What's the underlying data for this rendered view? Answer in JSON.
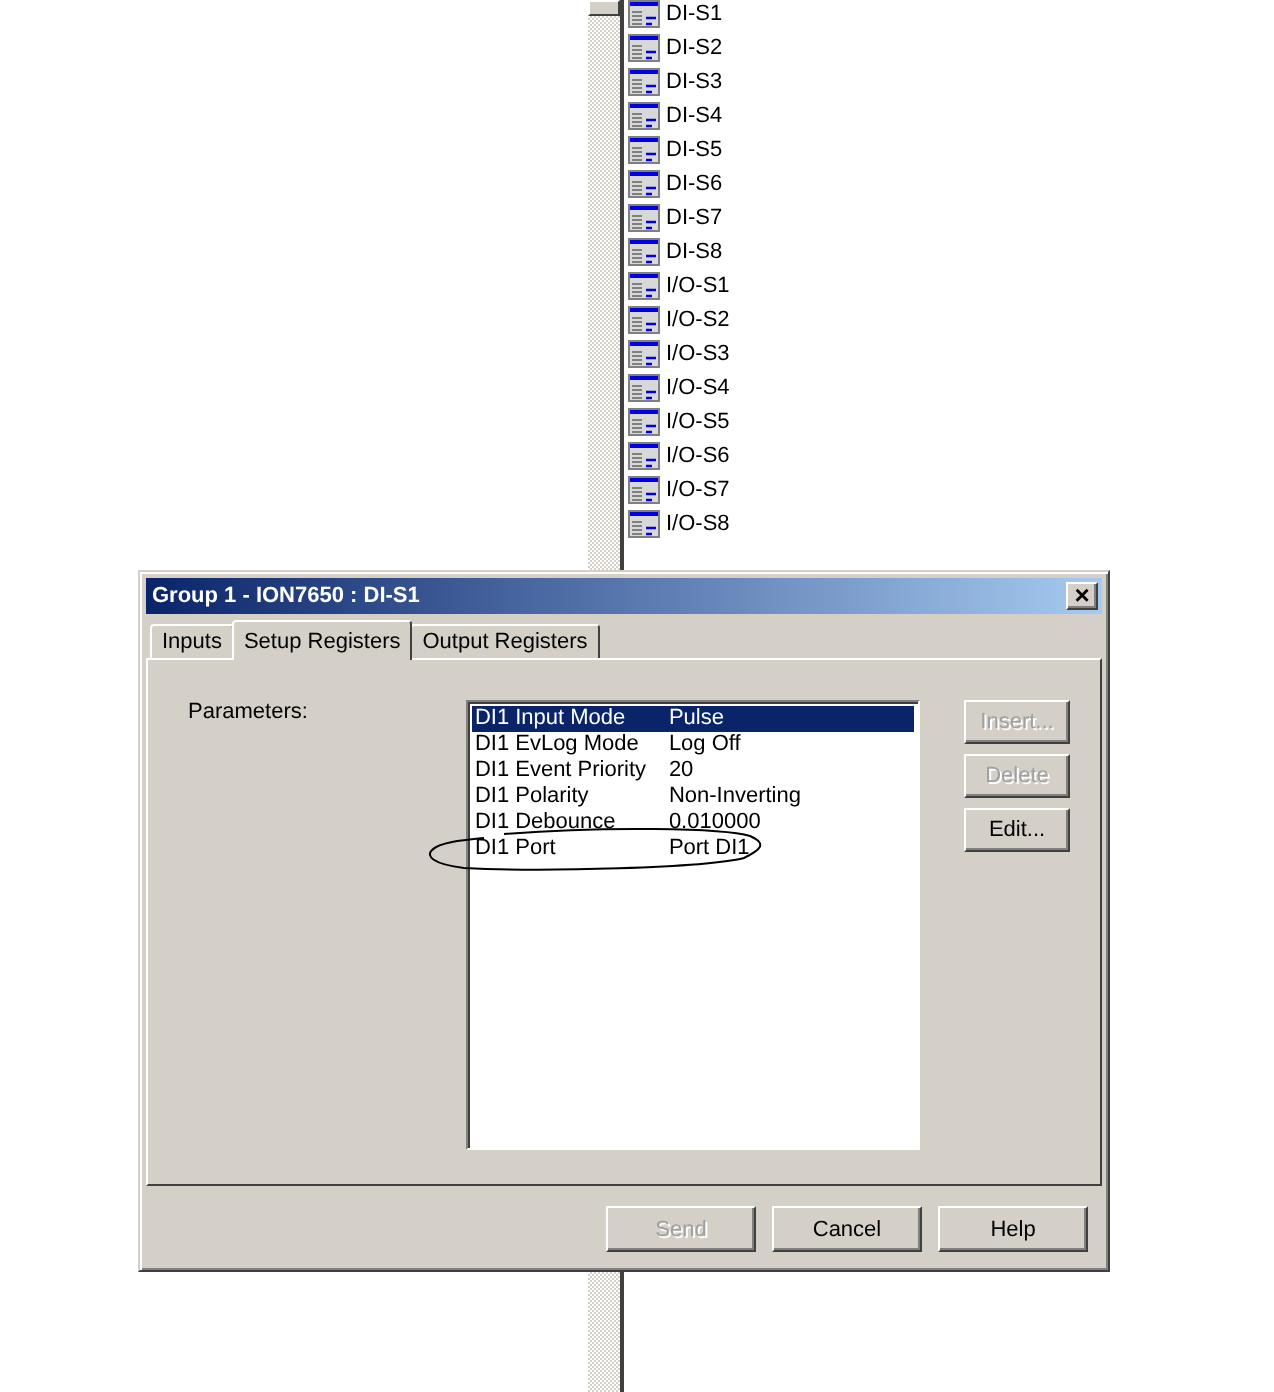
{
  "tree": {
    "items": [
      {
        "label": "DI-S1"
      },
      {
        "label": "DI-S2"
      },
      {
        "label": "DI-S3"
      },
      {
        "label": "DI-S4"
      },
      {
        "label": "DI-S5"
      },
      {
        "label": "DI-S6"
      },
      {
        "label": "DI-S7"
      },
      {
        "label": "DI-S8"
      },
      {
        "label": "I/O-S1"
      },
      {
        "label": "I/O-S2"
      },
      {
        "label": "I/O-S3"
      },
      {
        "label": "I/O-S4"
      },
      {
        "label": "I/O-S5"
      },
      {
        "label": "I/O-S6"
      },
      {
        "label": "I/O-S7"
      },
      {
        "label": "I/O-S8"
      }
    ]
  },
  "dialog": {
    "title": "Group 1 - ION7650 : DI-S1",
    "close": "×",
    "tabs": [
      {
        "label": "Inputs",
        "selected": false
      },
      {
        "label": "Setup Registers",
        "selected": true
      },
      {
        "label": "Output Registers",
        "selected": false
      }
    ],
    "parameters_label": "Parameters:",
    "parameters": [
      {
        "name": "DI1 Input Mode",
        "value": "Pulse",
        "selected": true
      },
      {
        "name": "DI1 EvLog Mode",
        "value": "Log Off",
        "selected": false
      },
      {
        "name": "DI1 Event Priority",
        "value": "20",
        "selected": false
      },
      {
        "name": "DI1 Polarity",
        "value": "Non-Inverting",
        "selected": false
      },
      {
        "name": "DI1 Debounce",
        "value": "0.010000",
        "selected": false
      },
      {
        "name": "DI1 Port",
        "value": "Port DI1",
        "selected": false
      }
    ],
    "side_buttons": [
      {
        "label": "Insert...",
        "disabled": true
      },
      {
        "label": "Delete",
        "disabled": true
      },
      {
        "label": "Edit...",
        "disabled": false
      }
    ],
    "footer_buttons": [
      {
        "label": "Send",
        "disabled": true
      },
      {
        "label": "Cancel",
        "disabled": false
      },
      {
        "label": "Help",
        "disabled": false
      }
    ]
  }
}
